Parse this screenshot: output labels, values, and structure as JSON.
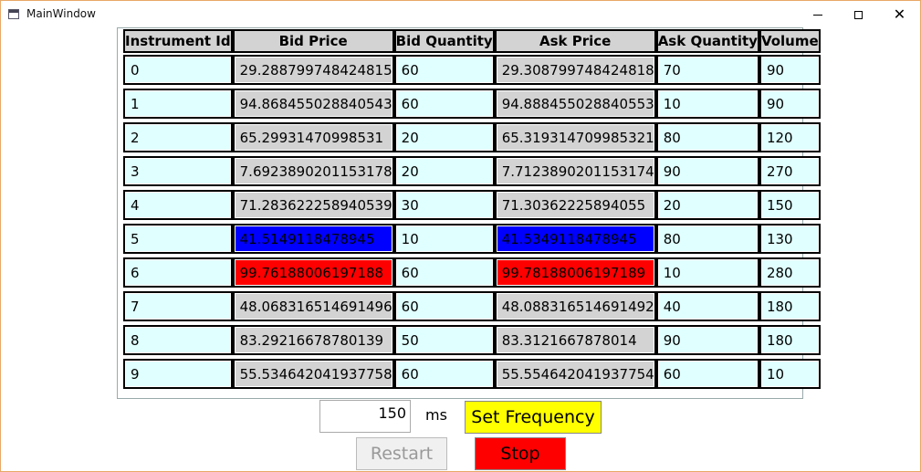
{
  "window": {
    "title": "MainWindow"
  },
  "grid": {
    "columns": [
      "Instrument Id",
      "Bid Price",
      "Bid Quantity",
      "Ask Price",
      "Ask Quantity",
      "Volume"
    ],
    "rows": [
      {
        "id": "0",
        "bid_price": "29.288799748424815",
        "bid_qty": "60",
        "ask_price": "29.308799748424818",
        "ask_qty": "70",
        "volume": "90",
        "highlight": ""
      },
      {
        "id": "1",
        "bid_price": "94.868455028840543",
        "bid_qty": "60",
        "ask_price": "94.888455028840553",
        "ask_qty": "10",
        "volume": "90",
        "highlight": ""
      },
      {
        "id": "2",
        "bid_price": "65.29931470998531",
        "bid_qty": "20",
        "ask_price": "65.319314709985321",
        "ask_qty": "80",
        "volume": "120",
        "highlight": ""
      },
      {
        "id": "3",
        "bid_price": "7.6923890201153178",
        "bid_qty": "20",
        "ask_price": "7.7123890201153174",
        "ask_qty": "90",
        "volume": "270",
        "highlight": ""
      },
      {
        "id": "4",
        "bid_price": "71.283622258940539",
        "bid_qty": "30",
        "ask_price": "71.30362225894055",
        "ask_qty": "20",
        "volume": "150",
        "highlight": ""
      },
      {
        "id": "5",
        "bid_price": "41.5149118478945",
        "bid_qty": "10",
        "ask_price": "41.5349118478945",
        "ask_qty": "80",
        "volume": "130",
        "highlight": "#0000ff"
      },
      {
        "id": "6",
        "bid_price": "99.76188006197188",
        "bid_qty": "60",
        "ask_price": "99.78188006197189",
        "ask_qty": "10",
        "volume": "280",
        "highlight": "#ff0000"
      },
      {
        "id": "7",
        "bid_price": "48.068316514691496",
        "bid_qty": "60",
        "ask_price": "48.088316514691492",
        "ask_qty": "40",
        "volume": "180",
        "highlight": ""
      },
      {
        "id": "8",
        "bid_price": "83.29216678780139",
        "bid_qty": "50",
        "ask_price": "83.3121667878014",
        "ask_qty": "90",
        "volume": "180",
        "highlight": ""
      },
      {
        "id": "9",
        "bid_price": "55.534642041937758",
        "bid_qty": "60",
        "ask_price": "55.554642041937754",
        "ask_qty": "60",
        "volume": "10",
        "highlight": ""
      }
    ]
  },
  "controls": {
    "frequency_value": "150",
    "frequency_unit": "ms",
    "set_frequency_label": "Set Frequency",
    "restart_label": "Restart",
    "stop_label": "Stop"
  },
  "colors": {
    "cell_cyan": "#e0ffff",
    "cell_grey": "#d3d3d3",
    "highlight_blue": "#0000ff",
    "highlight_red": "#ff0000",
    "set_frequency_bg": "#ffff00",
    "stop_bg": "#ff0000"
  }
}
